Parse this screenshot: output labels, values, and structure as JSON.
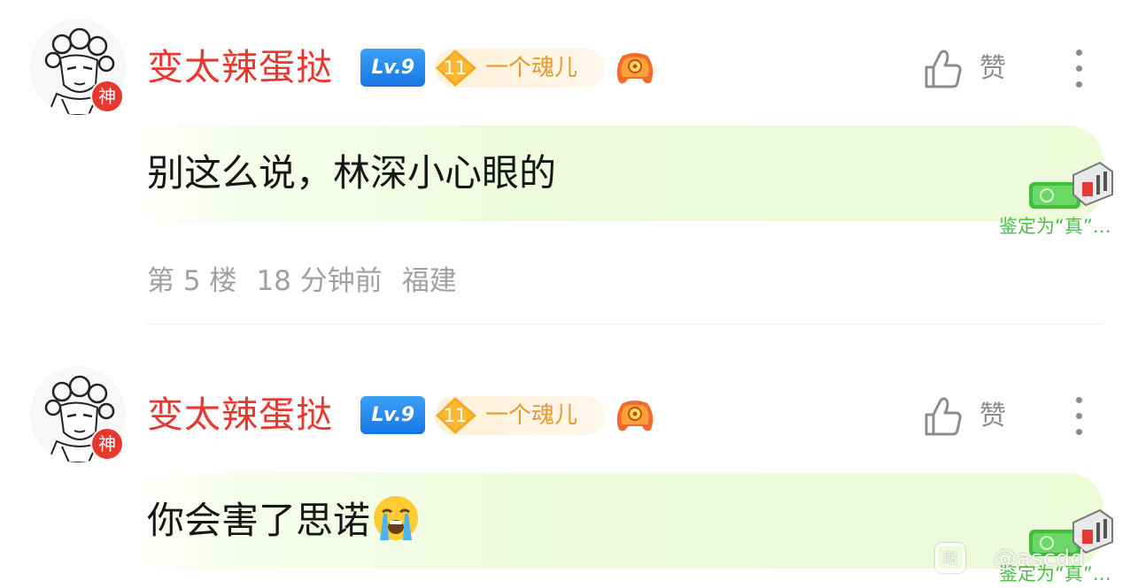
{
  "colors": {
    "username": "#e8372f",
    "level_badge": "#1675e6",
    "fan_badge_text": "#e59a2c",
    "meta_text": "#a0a0a0",
    "verify_text": "#4cbf47",
    "bubble": "#edfbd9"
  },
  "comments": [
    {
      "avatar_badge": "神",
      "username": "变太辣蛋挞",
      "level": "Lv.9",
      "fan_level": "11",
      "fan_name": "一个魂儿",
      "like_label": "赞",
      "text": "别这么说，林深小心眼的",
      "verify_label": "鉴定为“真”…",
      "floor": "第 5 楼",
      "time": "18 分钟前",
      "location": "福建"
    },
    {
      "avatar_badge": "神",
      "username": "变太辣蛋挞",
      "level": "Lv.9",
      "fan_level": "11",
      "fan_name": "一个魂儿",
      "like_label": "赞",
      "text": "你会害了思诺",
      "emoji": "loudly-crying-face-icon",
      "verify_label": "鉴定为“真”…"
    }
  ],
  "watermark": {
    "icon": "贴",
    "text": "@ascdd"
  }
}
